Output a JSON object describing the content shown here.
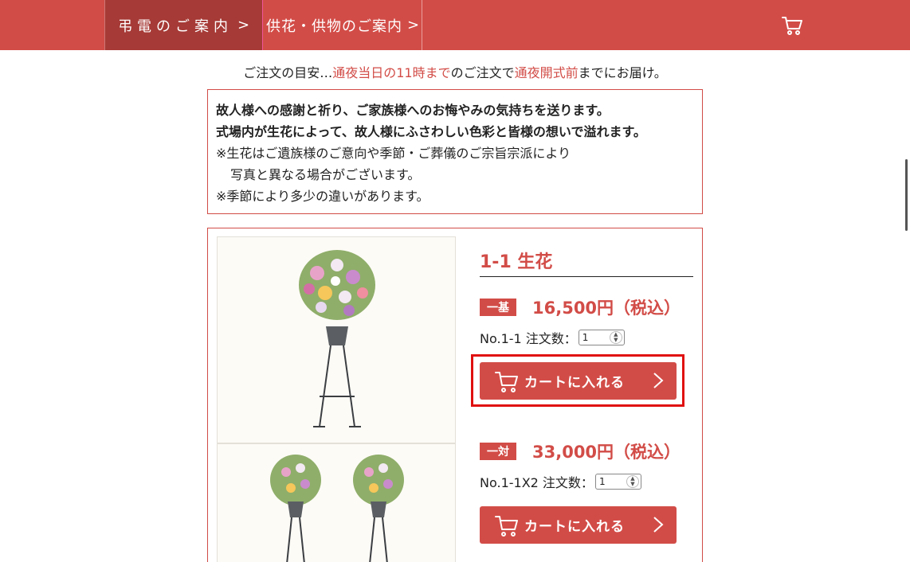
{
  "header": {
    "nav": [
      {
        "label": "弔電のご案内",
        "arrow": ">"
      },
      {
        "label": "供花・供物のご案内",
        "arrow": ">"
      }
    ],
    "cart_icon": "cart-icon"
  },
  "notice": {
    "prefix": "ご注文の目安…",
    "highlight1": "通夜当日の11時まで",
    "middle": "のご注文で",
    "highlight2": "通夜開式前",
    "suffix": "までにお届け。"
  },
  "info": {
    "line1": "故人様への感謝と祈り、ご家族様へのお悔やみの気持ちを送ります。",
    "line2": "式場内が生花によって、故人様にふさわしい色彩と皆様の想いで溢れます。",
    "line3": "※生花はご遺族様のご意向や季節・ご葬儀のご宗旨宗派により",
    "line4": "写真と異なる場合がございます。",
    "line5": "※季節により多少の違いがあります。"
  },
  "product": {
    "title": "1-1 生花",
    "options": [
      {
        "tag": "一基",
        "price": "16,500円（税込）",
        "qty_label": "No.1-1 注文数：",
        "qty": "1",
        "button": "カートに入れる"
      },
      {
        "tag": "一対",
        "price": "33,000円（税込）",
        "qty_label": "No.1-1X2 注文数：",
        "qty": "1",
        "button": "カートに入れる"
      }
    ]
  },
  "colors": {
    "brand": "#d24c47",
    "nav_active": "#a63a36",
    "highlight": "#e01010"
  }
}
